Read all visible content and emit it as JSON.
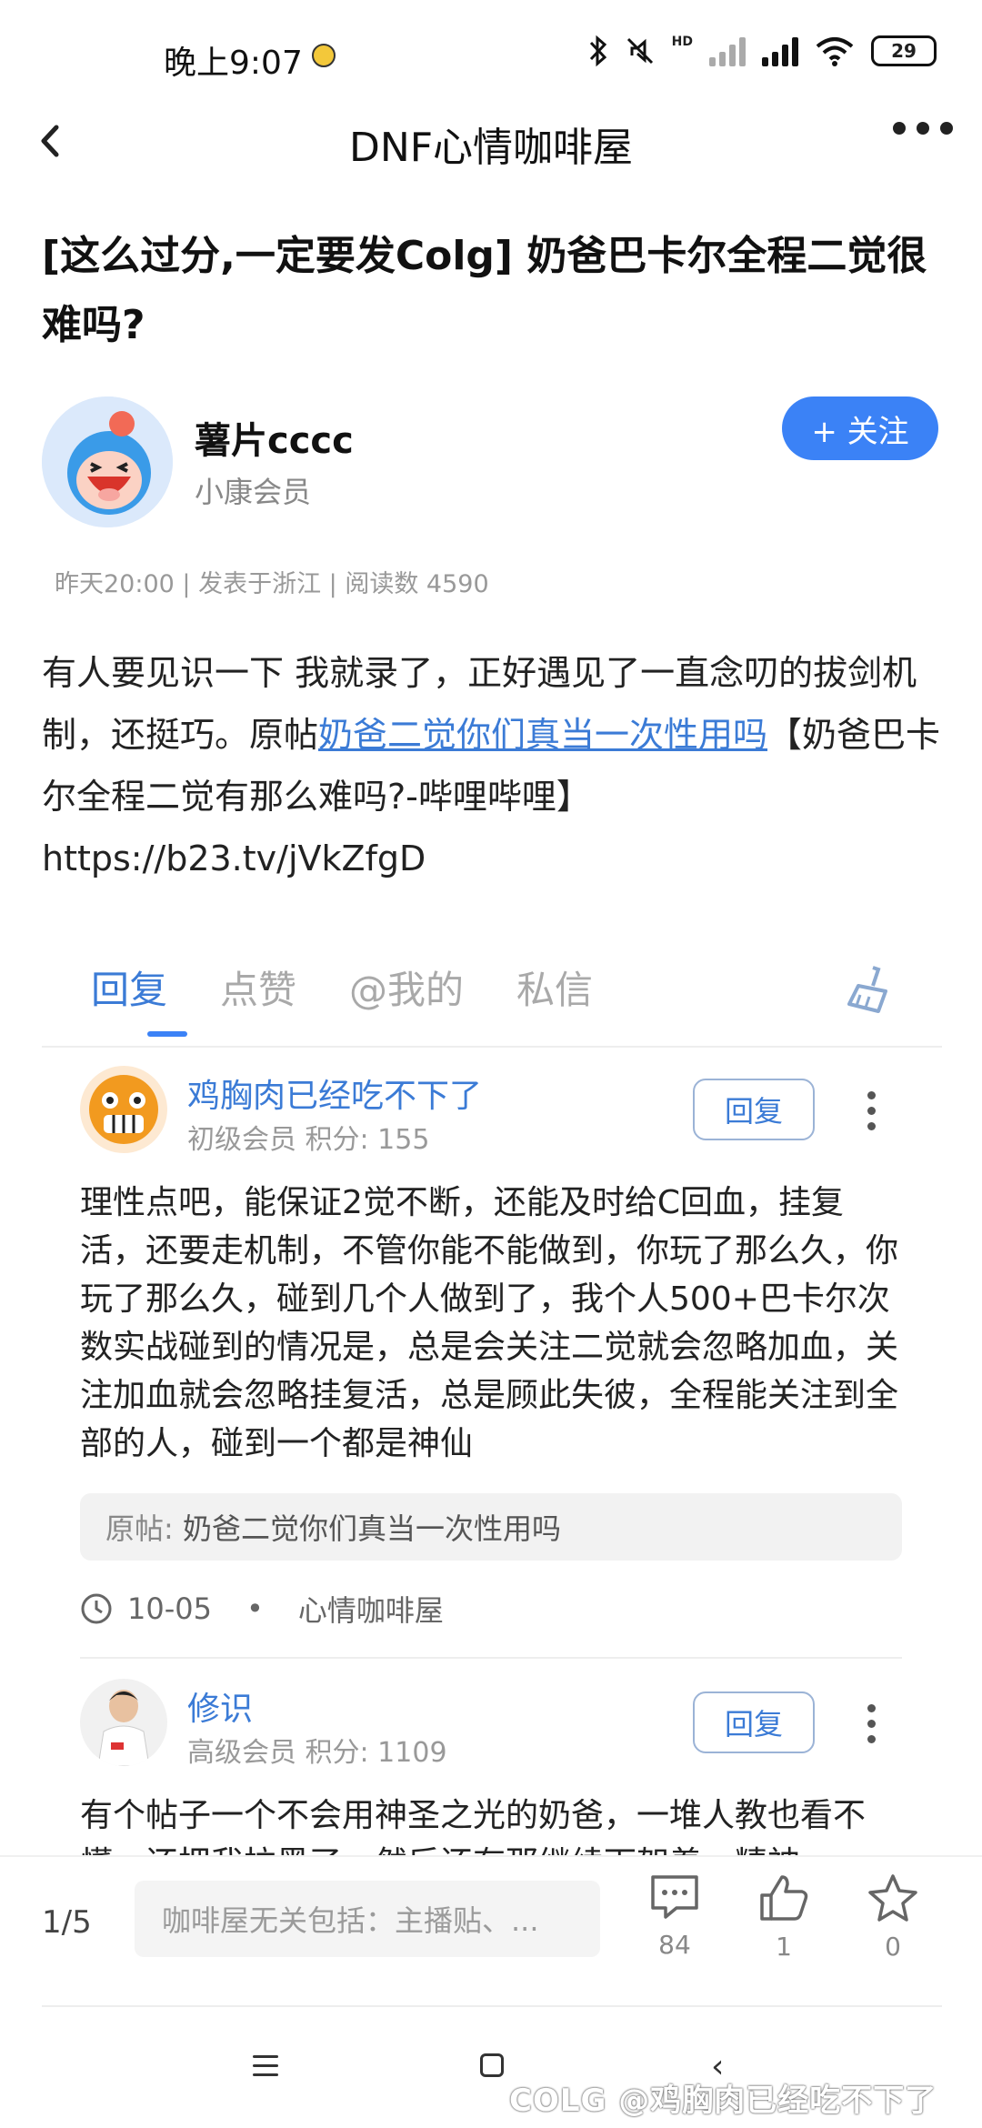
{
  "status_bar": {
    "time": "晚上9:07",
    "network": "HD",
    "battery": "29"
  },
  "header": {
    "title": "DNF心情咖啡屋"
  },
  "post": {
    "title": "[这么过分,一定要发Colg] 奶爸巴卡尔全程二觉很难吗?",
    "author": {
      "name": "薯片cccc",
      "level": "小康会员",
      "follow_label": "+ 关注"
    },
    "meta": "昨天20:00 | 发表于浙江 | 阅读数 4590",
    "body_part1": "有人要见识一下 我就录了，正好遇见了一直念叨的拔剑机制，还挺巧。原帖",
    "body_link": "奶爸二觉你们真当一次性用吗",
    "body_part2": "【奶爸巴卡尔全程二觉有那么难吗?-哔哩哔哩】",
    "body_url": "https://b23.tv/jVkZfgD"
  },
  "tabs": [
    {
      "label": "回复",
      "active": true
    },
    {
      "label": "点赞",
      "active": false
    },
    {
      "label": "@我的",
      "active": false
    },
    {
      "label": "私信",
      "active": false
    }
  ],
  "comments": [
    {
      "name": "鸡胸肉已经吃不下了",
      "level": "初级会员 积分: 155",
      "reply_label": "回复",
      "text": "理性点吧，能保证2觉不断，还能及时给C回血，挂复活，还要走机制，不管你能不能做到，你玩了那么久，你玩了那么久，碰到几个人做到了，我个人500+巴卡尔次数实战碰到的情况是，总是会关注二觉就会忽略加血，关注加血就会忽略挂复活，总是顾此失彼，全程能关注到全部的人，碰到一个都是神仙",
      "quote_label": "原帖:",
      "quote_text": "奶爸二觉你们真当一次性用吗",
      "date": "10-05",
      "dot": "•",
      "board": "心情咖啡屋"
    },
    {
      "name": "修识",
      "level": "高级会员 积分: 1109",
      "reply_label": "回复",
      "text": "有个帖子一个不会用神圣之光的奶爸，一堆人教也看不懂，还把我拉黑了，然后还有那继续下架着，精神"
    }
  ],
  "bottom_bar": {
    "page_indicator": "1/5",
    "input_placeholder": "咖啡屋无关包括：主播贴、...",
    "comment_count": "84",
    "like_count": "1",
    "favorite_count": "0"
  },
  "watermark": "COLG @鸡胸肉已经吃不下了",
  "colors": {
    "accent": "#3b82f6",
    "link": "#3b7bd6"
  }
}
